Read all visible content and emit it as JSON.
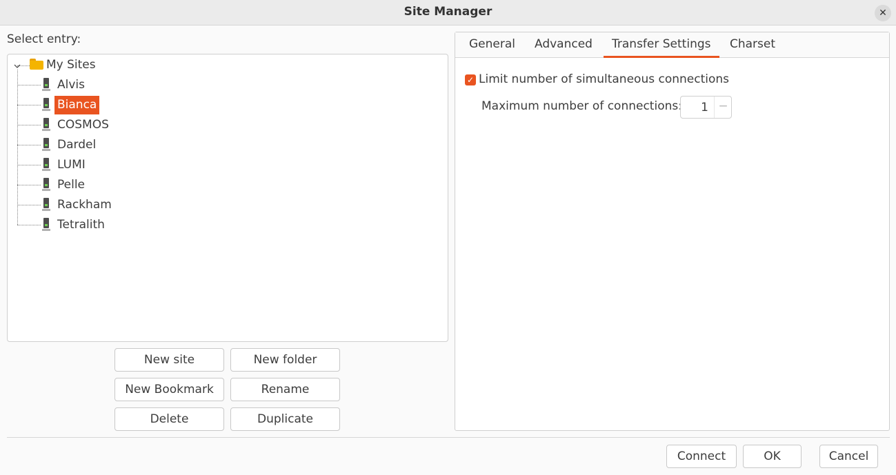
{
  "window": {
    "title": "Site Manager",
    "close_glyph": "✕"
  },
  "tree": {
    "label": "Select entry:",
    "root": {
      "label": "My Sites",
      "icon": "folder-icon",
      "expander": "chevron-down-icon"
    },
    "sites": [
      {
        "label": "Alvis",
        "selected": false
      },
      {
        "label": "Bianca",
        "selected": true
      },
      {
        "label": "COSMOS",
        "selected": false
      },
      {
        "label": "Dardel",
        "selected": false
      },
      {
        "label": "LUMI",
        "selected": false
      },
      {
        "label": "Pelle",
        "selected": false
      },
      {
        "label": "Rackham",
        "selected": false
      },
      {
        "label": "Tetralith",
        "selected": false
      }
    ]
  },
  "tree_buttons": {
    "new_site": "New site",
    "new_folder": "New folder",
    "new_bookmark": "New Bookmark",
    "rename": "Rename",
    "delete": "Delete",
    "duplicate": "Duplicate"
  },
  "tabs": [
    {
      "label": "General",
      "active": false
    },
    {
      "label": "Advanced",
      "active": false
    },
    {
      "label": "Transfer Settings",
      "active": true
    },
    {
      "label": "Charset",
      "active": false
    }
  ],
  "transfer_settings": {
    "limit_label": "Limit number of simultaneous connections",
    "limit_checked": true,
    "check_glyph": "✓",
    "max_label": "Maximum number of connections:",
    "max_value": "1",
    "minus_glyph": "−"
  },
  "dialog_buttons": {
    "connect": "Connect",
    "ok": "OK",
    "cancel": "Cancel"
  },
  "colors": {
    "accent": "#e95420",
    "checkbox": "#e95420"
  }
}
